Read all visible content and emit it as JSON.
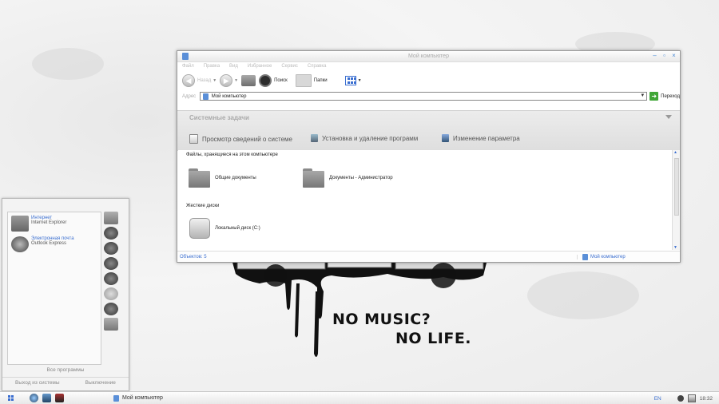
{
  "wallpaper": {
    "line1": "NO MUSIC?",
    "line2": "NO LIFE."
  },
  "window": {
    "title": "Мой компьютер",
    "controls": {
      "minimize": "–",
      "maximize": "▫",
      "close": "×"
    },
    "menu": [
      "Файл",
      "Правка",
      "Вид",
      "Избранное",
      "Сервис",
      "Справка"
    ],
    "toolbar": {
      "back_label": "Назад",
      "search_label": "Поиск",
      "folders_label": "Папки"
    },
    "address": {
      "label": "Адрес",
      "value": "Мой компьютер",
      "go_label": "Переход"
    },
    "tasks": {
      "header": "Системные задачи",
      "items": [
        "Просмотр сведений о системе",
        "Установка и удаление программ",
        "Изменение параметра"
      ]
    },
    "content": {
      "section1": "Файлы, хранящиеся на этом компьютере",
      "files": [
        "Общие документы",
        "Документы - Администратор"
      ],
      "section2": "Жесткие диски",
      "drives": [
        "Локальный диск (C:)"
      ]
    },
    "status": {
      "objects": "Объектов: 5",
      "location": "Мой компьютер"
    }
  },
  "startmenu": {
    "pinned": [
      {
        "title": "Интернет",
        "subtitle": "Internet Explorer"
      },
      {
        "title": "Электронная почта",
        "subtitle": "Outlook Express"
      }
    ],
    "all_programs": "Все программы",
    "logoff": "Выход из системы",
    "shutdown": "Выключение"
  },
  "taskbar": {
    "active_app": "Мой компьютер",
    "language": "EN",
    "clock": "18:32"
  },
  "colors": {
    "accent": "#3a6ed0",
    "go": "#3fa636"
  }
}
